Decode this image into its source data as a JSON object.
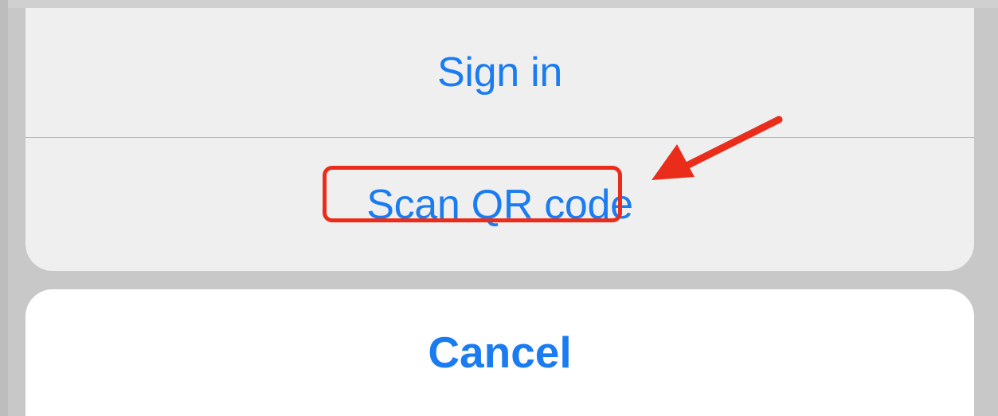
{
  "action_sheet": {
    "items": [
      {
        "label": "Sign in"
      },
      {
        "label": "Scan QR code"
      }
    ],
    "cancel_label": "Cancel"
  },
  "annotation": {
    "highlight_color": "#ea2d1b",
    "arrow_color": "#ea2d1b"
  },
  "colors": {
    "accent": "#1a7cf0",
    "sheet_background": "#efefef",
    "cancel_background": "#ffffff",
    "backdrop": "#c8c8c8"
  }
}
